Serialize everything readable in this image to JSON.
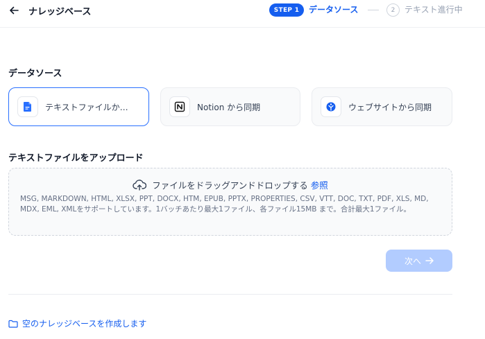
{
  "header": {
    "title": "ナレッジベース",
    "step1_badge": "STEP 1",
    "step1_label": "データソース",
    "step2_number": "2",
    "step2_label": "テキスト進行中"
  },
  "datasource": {
    "section_title": "データソース",
    "options": [
      {
        "label": "テキストファイルか…",
        "icon": "document-icon",
        "selected": true
      },
      {
        "label": "Notion から同期",
        "icon": "notion-icon",
        "selected": false
      },
      {
        "label": "ウェブサイトから同期",
        "icon": "website-icon",
        "selected": false
      }
    ]
  },
  "upload": {
    "section_title": "テキストファイルをアップロード",
    "drop_text": "ファイルをドラッグアンドドロップする",
    "browse_label": "参照",
    "hint": "MSG, MARKDOWN, HTML, XLSX, PPT, DOCX, HTM, EPUB, PPTX, PROPERTIES, CSV, VTT, DOC, TXT, PDF, XLS, MD, MDX, EML, XMLをサポートしています。1バッチあたり最大1ファイル、各ファイル15MB まで。合計最大1ファイル。"
  },
  "actions": {
    "next_label": "次へ",
    "empty_kb_label": "空のナレッジベースを作成します"
  },
  "colors": {
    "accent": "#155eef",
    "disabled_button": "#b2ccff"
  }
}
